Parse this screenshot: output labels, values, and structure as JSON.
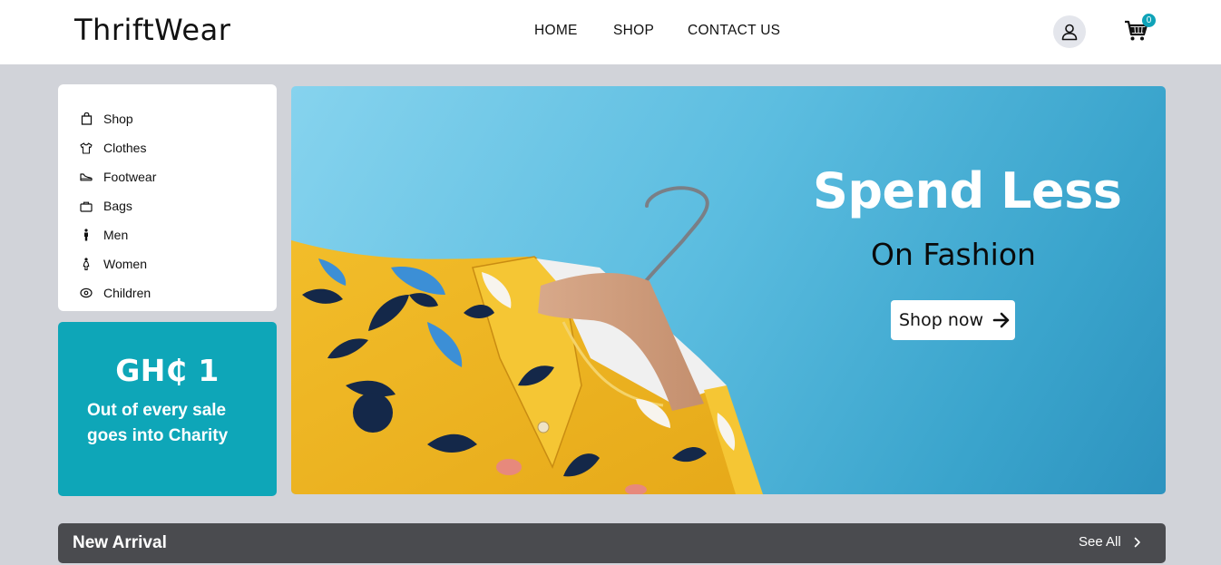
{
  "header": {
    "logo": "ThriftWear",
    "nav": {
      "home": "HOME",
      "shop": "SHOP",
      "contact": "CONTACT US"
    },
    "user_icon": "user-icon",
    "cart_icon": "cart-icon",
    "cart_count": "0"
  },
  "sidebar": {
    "items": [
      {
        "label": "Shop",
        "icon": "shopping-bag-icon"
      },
      {
        "label": "Clothes",
        "icon": "tshirt-icon"
      },
      {
        "label": "Footwear",
        "icon": "shoe-icon"
      },
      {
        "label": "Bags",
        "icon": "bag-icon"
      },
      {
        "label": "Men",
        "icon": "male-icon"
      },
      {
        "label": "Women",
        "icon": "female-icon"
      },
      {
        "label": "Children",
        "icon": "child-icon"
      }
    ]
  },
  "charity": {
    "amount": "GH₵ 1",
    "note": "Out of every sale goes into Charity"
  },
  "hero": {
    "headline": "Spend Less",
    "subheadline": "On Fashion",
    "cta_label": "Shop now",
    "cta_icon": "arrow-right-icon"
  },
  "new_arrival": {
    "title": "New Arrival",
    "see_all": "See All",
    "see_all_icon": "chevron-right-icon"
  },
  "colors": {
    "page_bg": "#d1d3d9",
    "accent_teal": "#0ea6b8",
    "hero_blue": "#5cbde0",
    "bar_dark": "#4a4b4f"
  }
}
